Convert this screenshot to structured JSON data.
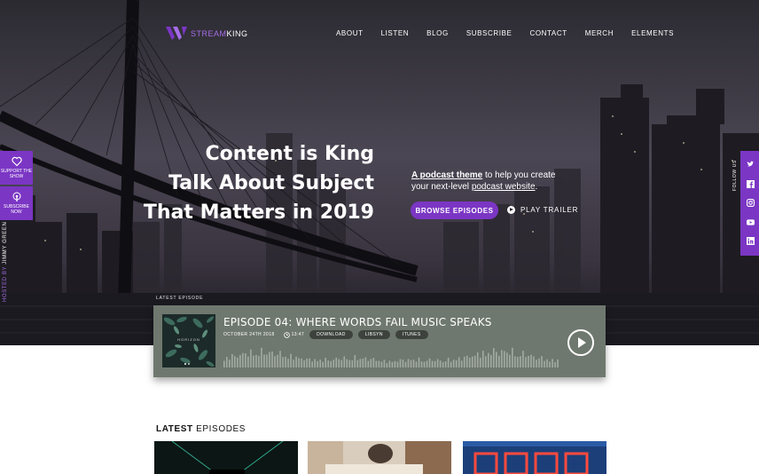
{
  "brand": {
    "name_part1": "STREAM",
    "name_part2": "KING",
    "accent": "#7b36c4"
  },
  "nav": [
    "ABOUT",
    "LISTEN",
    "BLOG",
    "SUBSCRIBE",
    "CONTACT",
    "MERCH",
    "ELEMENTS"
  ],
  "hero": {
    "headline": [
      "Content is King",
      "Talk About Subject",
      "That Matters in 2019"
    ],
    "tagline_link1": "A podcast theme",
    "tagline_mid": " to help you create your next-level ",
    "tagline_link2": "podcast website",
    "tagline_end": ".",
    "browse_label": "BROWSE EPISODES",
    "trailer_label": "PLAY TRAILER"
  },
  "side": {
    "support_label": "SUPPORT THE SHOW",
    "subscribe_label": "SUBSCRIBE NOW",
    "hosted_by": "HOSTED BY",
    "host_name": "JIMMY GREEN",
    "follow_label": "FOLLOW US",
    "social_icons": [
      "twitter-icon",
      "facebook-icon",
      "instagram-icon",
      "youtube-icon",
      "linkedin-icon"
    ]
  },
  "player": {
    "section_label": "LATEST EPISODE",
    "cover_title": "HORIZON",
    "title": "EPISODE 04: WHERE WORDS FAIL MUSIC SPEAKS",
    "date": "OCTOBER 24TH 2018",
    "duration": "13:47",
    "pills": [
      "DOWNLOAD",
      "LIBSYN",
      "ITUNES"
    ]
  },
  "latest": {
    "bold": "LATEST",
    "rest": " EPISODES"
  }
}
